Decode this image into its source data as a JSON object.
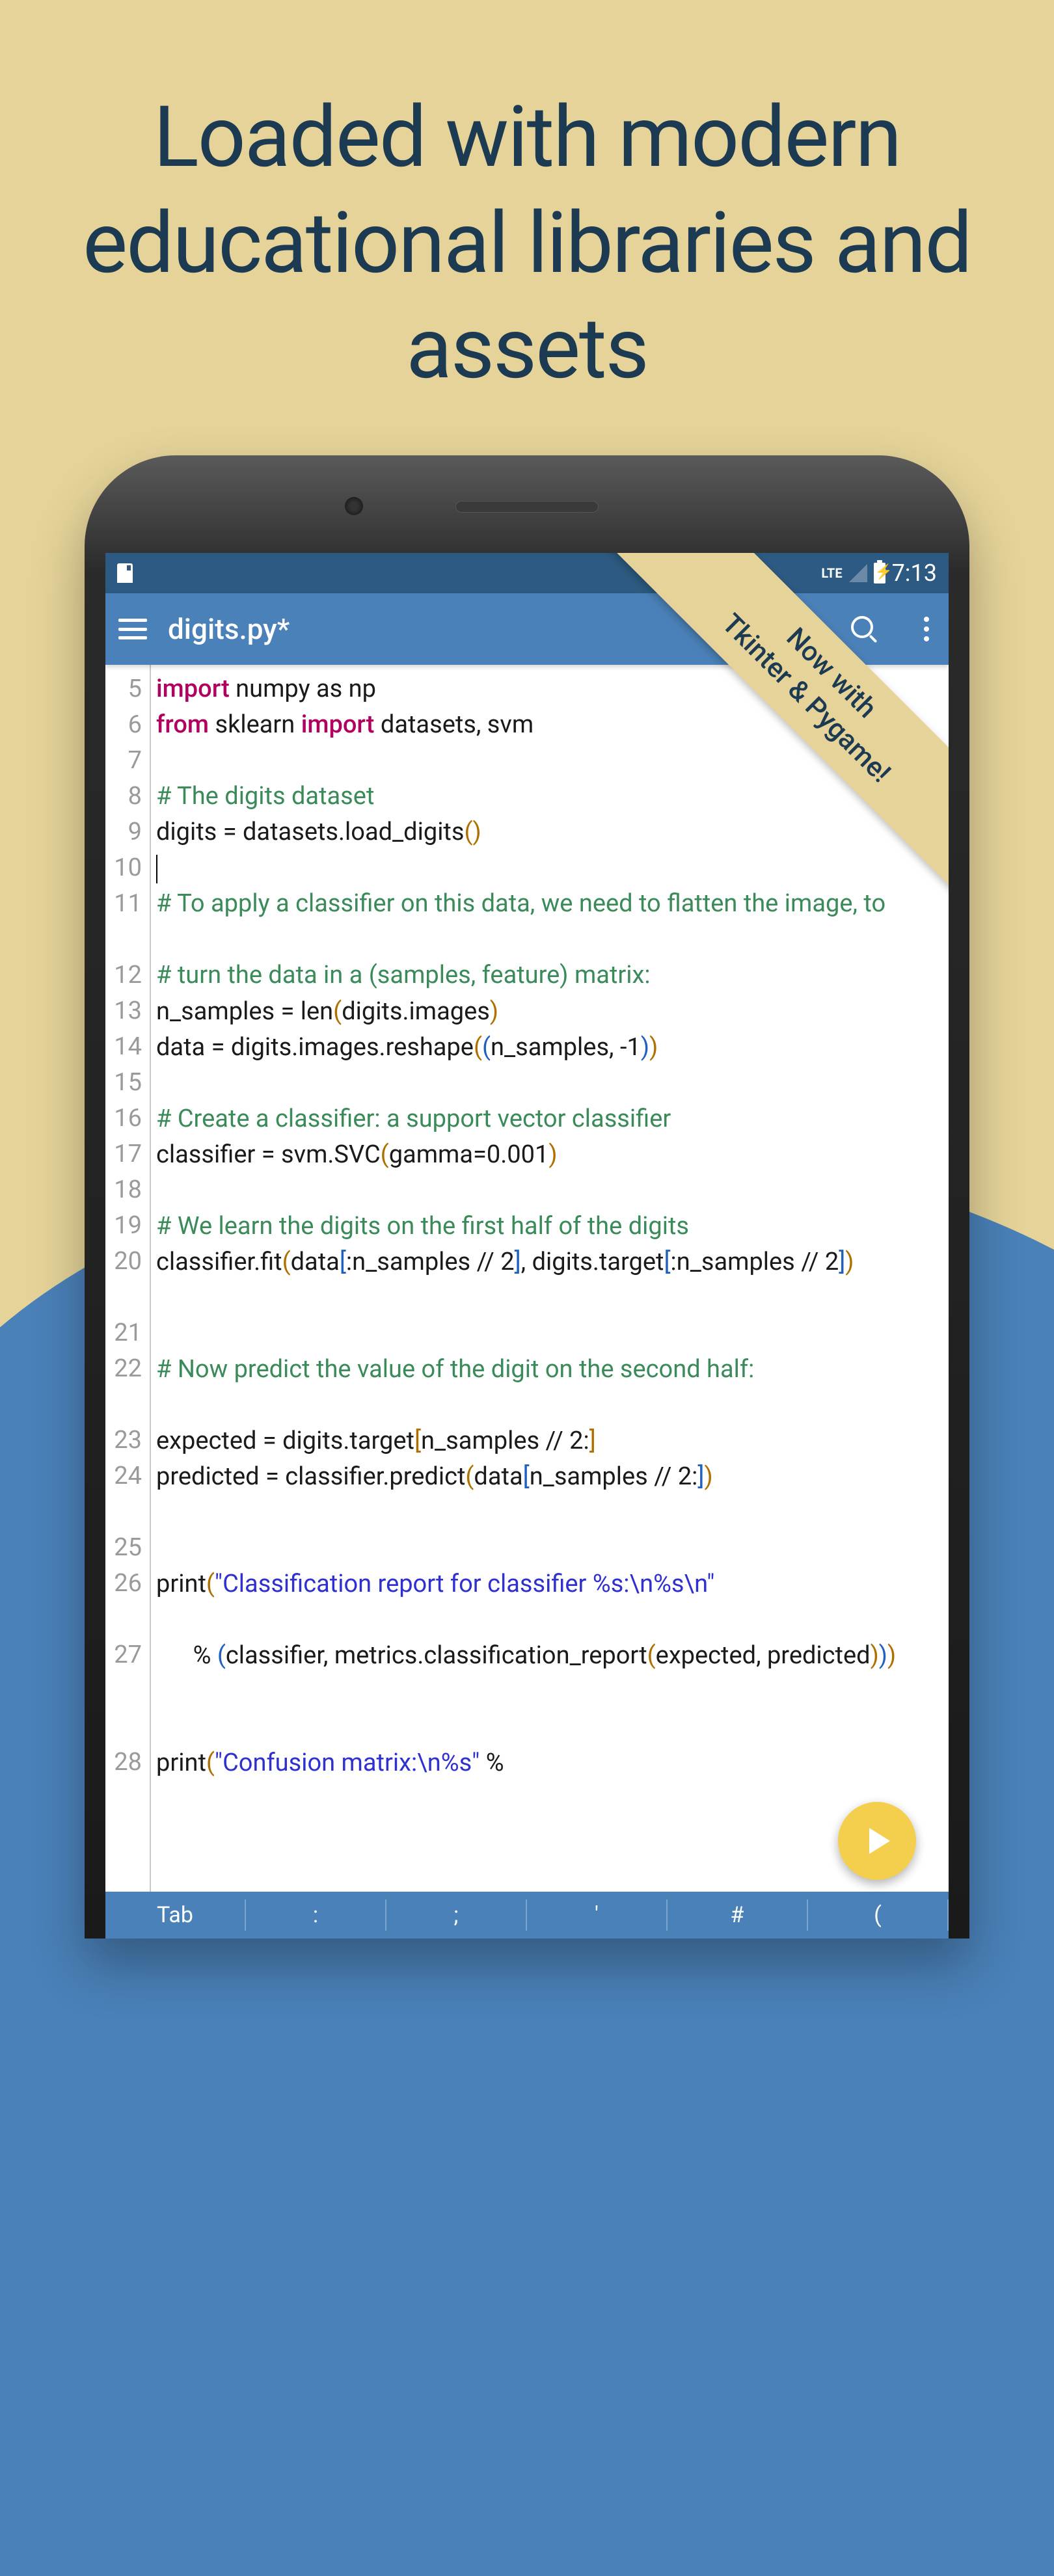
{
  "promo": {
    "headline": "Loaded with modern educational libraries and assets",
    "ribbon_line1": "Now with",
    "ribbon_line2": "Tkinter & Pygame!"
  },
  "status": {
    "network": "LTE",
    "time": "7:13"
  },
  "appbar": {
    "title": "digits.py*"
  },
  "code": {
    "lines": [
      {
        "n": 5,
        "tokens": [
          {
            "t": "import ",
            "c": "kw"
          },
          {
            "t": "numpy as np"
          }
        ]
      },
      {
        "n": 6,
        "tokens": [
          {
            "t": "from ",
            "c": "kw"
          },
          {
            "t": "sklearn "
          },
          {
            "t": "import ",
            "c": "kw"
          },
          {
            "t": "datasets, svm"
          }
        ]
      },
      {
        "n": 7,
        "tokens": []
      },
      {
        "n": 8,
        "tokens": [
          {
            "t": "# The digits dataset",
            "c": "comment"
          }
        ]
      },
      {
        "n": 9,
        "tokens": [
          {
            "t": "digits = datasets.load_digits"
          },
          {
            "t": "()",
            "c": "paren1"
          }
        ]
      },
      {
        "n": 10,
        "tokens": [
          {
            "t": "",
            "cursor": true
          }
        ]
      },
      {
        "n": 11,
        "wrap": 2,
        "tokens": [
          {
            "t": "# To apply a classifier on this data, we need to flatten the image, to",
            "c": "comment"
          }
        ]
      },
      {
        "n": 12,
        "tokens": [
          {
            "t": "# turn the data in a (samples, feature) matrix:",
            "c": "comment"
          }
        ]
      },
      {
        "n": 13,
        "tokens": [
          {
            "t": "n_samples = len"
          },
          {
            "t": "(",
            "c": "paren1"
          },
          {
            "t": "digits.images"
          },
          {
            "t": ")",
            "c": "paren1"
          }
        ]
      },
      {
        "n": 14,
        "tokens": [
          {
            "t": "data = digits.images.reshape"
          },
          {
            "t": "(",
            "c": "paren1"
          },
          {
            "t": "(",
            "c": "paren2"
          },
          {
            "t": "n_samples, -1"
          },
          {
            "t": ")",
            "c": "paren2"
          },
          {
            "t": ")",
            "c": "paren1"
          }
        ]
      },
      {
        "n": 15,
        "tokens": []
      },
      {
        "n": 16,
        "tokens": [
          {
            "t": "# Create a classifier: a support vector classifier",
            "c": "comment"
          }
        ]
      },
      {
        "n": 17,
        "tokens": [
          {
            "t": "classifier = svm.SVC"
          },
          {
            "t": "(",
            "c": "paren1"
          },
          {
            "t": "gamma=0.001"
          },
          {
            "t": ")",
            "c": "paren1"
          }
        ]
      },
      {
        "n": 18,
        "tokens": []
      },
      {
        "n": 19,
        "tokens": [
          {
            "t": "# We learn the digits on the first half of the digits",
            "c": "comment"
          }
        ]
      },
      {
        "n": 20,
        "wrap": 2,
        "tokens": [
          {
            "t": "classifier.fit"
          },
          {
            "t": "(",
            "c": "paren1"
          },
          {
            "t": "data"
          },
          {
            "t": "[",
            "c": "paren2"
          },
          {
            "t": ":n_samples // 2"
          },
          {
            "t": "]",
            "c": "paren2"
          },
          {
            "t": ", digits.target"
          },
          {
            "t": "[",
            "c": "paren2"
          },
          {
            "t": ":n_samples // 2"
          },
          {
            "t": "]",
            "c": "paren2"
          },
          {
            "t": ")",
            "c": "paren1"
          }
        ]
      },
      {
        "n": 21,
        "tokens": []
      },
      {
        "n": 22,
        "wrap": 2,
        "tokens": [
          {
            "t": "# Now predict the value of the digit on the second half:",
            "c": "comment"
          }
        ]
      },
      {
        "n": 23,
        "tokens": [
          {
            "t": "expected = digits.target"
          },
          {
            "t": "[",
            "c": "paren1"
          },
          {
            "t": "n_samples // 2:"
          },
          {
            "t": "]",
            "c": "paren1"
          }
        ]
      },
      {
        "n": 24,
        "wrap": 2,
        "tokens": [
          {
            "t": "predicted = classifier.predict"
          },
          {
            "t": "(",
            "c": "paren1"
          },
          {
            "t": "data"
          },
          {
            "t": "[",
            "c": "paren2"
          },
          {
            "t": "n_samples // 2:"
          },
          {
            "t": "]",
            "c": "paren2"
          },
          {
            "t": ")",
            "c": "paren1"
          }
        ]
      },
      {
        "n": 25,
        "tokens": []
      },
      {
        "n": 26,
        "wrap": 2,
        "tokens": [
          {
            "t": "print"
          },
          {
            "t": "(",
            "c": "paren1"
          },
          {
            "t": "\"Classification report for classifier %s:\\n%s\\n\"",
            "c": "str"
          }
        ]
      },
      {
        "n": 27,
        "wrap": 3,
        "tokens": [
          {
            "t": "      % "
          },
          {
            "t": "(",
            "c": "paren2"
          },
          {
            "t": "classifier, metrics.classification_report"
          },
          {
            "t": "(",
            "c": "paren1"
          },
          {
            "t": "expected, predicted"
          },
          {
            "t": ")",
            "c": "paren1"
          },
          {
            "t": ")",
            "c": "paren2"
          },
          {
            "t": ")",
            "c": "paren1"
          }
        ]
      },
      {
        "n": 28,
        "tokens": [
          {
            "t": "print"
          },
          {
            "t": "(",
            "c": "paren1"
          },
          {
            "t": "\"Confusion matrix:\\n%s\"",
            "c": "str"
          },
          {
            "t": " %"
          }
        ]
      }
    ]
  },
  "keyrow": {
    "keys": [
      "Tab",
      ":",
      ";",
      "'",
      "#",
      "("
    ]
  }
}
